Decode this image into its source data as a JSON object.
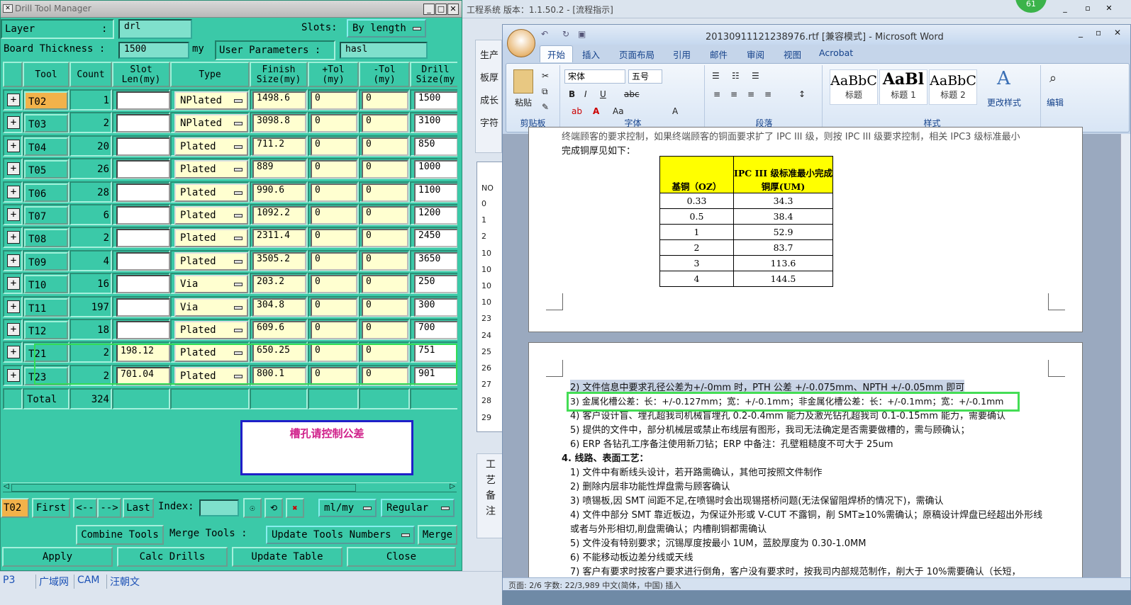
{
  "dtm": {
    "title": "Drill Tool Manager",
    "layer_label": "Layer",
    "layer_colon": ":",
    "layer_value": "drl",
    "slots_label": "Slots:",
    "slots_value": "By length",
    "board_thickness_label": "Board Thickness :",
    "board_thickness_value": "1500",
    "board_thickness_unit": "my",
    "user_params_label": "User Parameters :",
    "user_params_value": "hasl",
    "headers": {
      "tool": "Tool",
      "count": "Count",
      "slot_len_1": "Slot",
      "slot_len_2": "Len(my)",
      "type": "Type",
      "finish_1": "Finish",
      "finish_2": "Size(my)",
      "ptol_1": "+Tol",
      "ptol_2": "(my)",
      "ntol_1": "-Tol",
      "ntol_2": "(my)",
      "drill_1": "Drill",
      "drill_2": "Size(my"
    },
    "rows": [
      {
        "tool": "T02",
        "count": "1",
        "slot": "",
        "type": "NPlated",
        "finish": "1498.6",
        "ptol": "0",
        "ntol": "0",
        "drill": "1500"
      },
      {
        "tool": "T03",
        "count": "2",
        "slot": "",
        "type": "NPlated",
        "finish": "3098.8",
        "ptol": "0",
        "ntol": "0",
        "drill": "3100"
      },
      {
        "tool": "T04",
        "count": "20",
        "slot": "",
        "type": "Plated",
        "finish": "711.2",
        "ptol": "0",
        "ntol": "0",
        "drill": "850"
      },
      {
        "tool": "T05",
        "count": "26",
        "slot": "",
        "type": "Plated",
        "finish": "889",
        "ptol": "0",
        "ntol": "0",
        "drill": "1000"
      },
      {
        "tool": "T06",
        "count": "28",
        "slot": "",
        "type": "Plated",
        "finish": "990.6",
        "ptol": "0",
        "ntol": "0",
        "drill": "1100"
      },
      {
        "tool": "T07",
        "count": "6",
        "slot": "",
        "type": "Plated",
        "finish": "1092.2",
        "ptol": "0",
        "ntol": "0",
        "drill": "1200"
      },
      {
        "tool": "T08",
        "count": "2",
        "slot": "",
        "type": "Plated",
        "finish": "2311.4",
        "ptol": "0",
        "ntol": "0",
        "drill": "2450"
      },
      {
        "tool": "T09",
        "count": "4",
        "slot": "",
        "type": "Plated",
        "finish": "3505.2",
        "ptol": "0",
        "ntol": "0",
        "drill": "3650"
      },
      {
        "tool": "T10",
        "count": "16",
        "slot": "",
        "type": "Via",
        "finish": "203.2",
        "ptol": "0",
        "ntol": "0",
        "drill": "250"
      },
      {
        "tool": "T11",
        "count": "197",
        "slot": "",
        "type": "Via",
        "finish": "304.8",
        "ptol": "0",
        "ntol": "0",
        "drill": "300"
      },
      {
        "tool": "T12",
        "count": "18",
        "slot": "",
        "type": "Plated",
        "finish": "609.6",
        "ptol": "0",
        "ntol": "0",
        "drill": "700"
      },
      {
        "tool": "T21",
        "count": "2",
        "slot": "198.12",
        "type": "Plated",
        "finish": "650.25",
        "ptol": "0",
        "ntol": "0",
        "drill": "751"
      },
      {
        "tool": "T23",
        "count": "2",
        "slot": "701.04",
        "type": "Plated",
        "finish": "800.1",
        "ptol": "0",
        "ntol": "0",
        "drill": "901"
      }
    ],
    "total_label": "Total",
    "total_value": "324",
    "note": "槽孔请控制公差",
    "nav": {
      "current_tool": "T02",
      "first": "First",
      "prev": "<--",
      "next": "-->",
      "last": "Last",
      "index_label": "Index:",
      "unit_value": "ml/my",
      "mode_value": "Regular"
    },
    "buttons": {
      "combine_tools": "Combine Tools",
      "merge_tools_label": "Merge Tools :",
      "update_tools_numbers": "Update Tools Numbers",
      "merge": "Merge",
      "apply": "Apply",
      "calc_drills": "Calc Drills",
      "update_table": "Update Table",
      "close": "Close"
    }
  },
  "bgapp": {
    "title": "工程系统  版本：1.1.50.2 - [流程指示]",
    "side_labels": [
      "生产",
      "板厚",
      "成长",
      "字符"
    ],
    "no_header": "NO",
    "no_values": [
      "0",
      "1",
      "2",
      "10",
      "10",
      "10",
      "10",
      "23",
      "24",
      "25",
      "26",
      "27",
      "28",
      "29"
    ],
    "vertical_label": [
      "工",
      "艺",
      "备",
      "注"
    ],
    "badge": "61"
  },
  "word": {
    "title": "20130911121238976.rtf [兼容模式] - Microsoft Word",
    "tabs": [
      "开始",
      "插入",
      "页面布局",
      "引用",
      "邮件",
      "审阅",
      "视图",
      "Acrobat"
    ],
    "groups": {
      "clipboard": "剪贴板",
      "font": "字体",
      "paragraph": "段落",
      "styles": "样式",
      "edit": "编辑"
    },
    "paste_label": "粘贴",
    "font_name": "宋体",
    "font_size": "五号",
    "styles": [
      {
        "preview": "AaBbC",
        "name": "标题"
      },
      {
        "preview": "AaBl",
        "name": "标题 1"
      },
      {
        "preview": "AaBbC",
        "name": "标题 2"
      }
    ],
    "change_styles": "更改样式",
    "edit_label": "编辑",
    "page1_line1": "终端顾客的要求控制，如果终端顾客的铜面要求扩了 IPC III 级，则按 IPC III 级要求控制，相关 IPC3 级标准最小",
    "page1_line2": "完成铜厚见如下：",
    "table": {
      "header_1": "基铜（OZ）",
      "header_2": "IPC III 级标准最小完成铜厚(UM)",
      "rows": [
        [
          "0.33",
          "34.3"
        ],
        [
          "0.5",
          "38.4"
        ],
        [
          "1",
          "52.9"
        ],
        [
          "2",
          "83.7"
        ],
        [
          "3",
          "113.6"
        ],
        [
          "4",
          "144.5"
        ]
      ]
    },
    "page2_lines": [
      "2)  文件信息中要求孔径公差为+/-0mm 时，PTH 公差 +/-0.075mm、NPTH +/-0.05mm 即可",
      "3)  金属化槽公差：长：+/-0.127mm；宽：+/-0.1mm；非金属化槽公差：长：+/-0.1mm；宽：+/-0.1mm",
      "4)  客户设计盲、埋孔超我司机械盲埋孔 0.2-0.4mm 能力及激光钻孔超我司 0.1-0.15mm 能力，需要确认",
      "5)  提供的文件中，部分机械层或禁止布线层有图形，我司无法确定是否需要做槽的，需与顾确认；",
      "6)  ERP 各钻孔工序备注使用新刀钻；ERP 中备注：孔壁粗糙度不可大于 25um",
      "4.   线路、表面工艺：",
      "1)  文件中有断线头设计，若开路需确认，其他可按照文件制作",
      "2)  删除内层非功能性焊盘需与顾客确认",
      "3)  喷锡板,因 SMT 间距不足,在喷锡时会出现锡搭桥问题(无法保留阻焊桥的情况下)，需确认",
      "4)  文件中部分 SMT 靠近板边，为保证外形或 V-CUT 不露铜，削 SMT≥10%需确认；原稿设计焊盘已经超出外形线",
      "     或者与外形相切,削盘需确认；内槽削铜都需确认",
      "5)  文件没有特别要求；沉锡厚度按最小 1UM，蓝胶厚度为 0.30-1.0MM",
      "6)  不能移动板边差分线或天线",
      "7)  客户有要求时按客户要求进行倒角，客户没有要求时，按我司内部规范制作，削大于 10%需要确认（长短，"
    ],
    "status": "页面: 2/6    字数: 22/3,989    中文(简体，中国)    插入"
  },
  "taskbar": {
    "items": [
      "P3",
      "广域网",
      "CAM",
      "汪朝文"
    ]
  }
}
